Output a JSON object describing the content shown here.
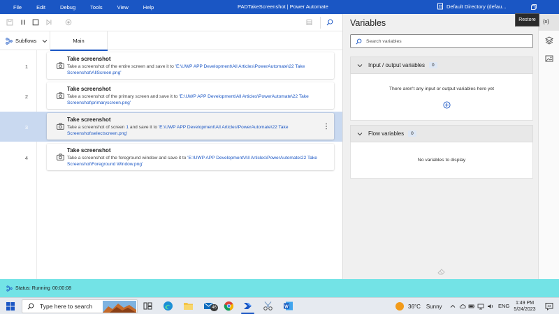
{
  "titlebar": {
    "menu": [
      "File",
      "Edit",
      "Debug",
      "Tools",
      "View",
      "Help"
    ],
    "title": "PADTakeScreenshot | Power Automate",
    "directory": "Default Directory (defau...",
    "restore_tooltip": "Restore"
  },
  "toolbar": {
    "icons": [
      "save-icon",
      "pause-icon",
      "stop-icon",
      "run-next-icon",
      "record-icon",
      "ui-elements-icon",
      "search-icon"
    ]
  },
  "tabs": {
    "subflows_label": "Subflows",
    "main_label": "Main"
  },
  "actions": [
    {
      "number": "1",
      "title": "Take screenshot",
      "desc_prefix": "Take a screenshot of the entire screen and save it to ",
      "path": "'E:\\UWP APP Development\\All Articles\\PowerAutomate\\22 Take Screenshot\\AllScreen.png'"
    },
    {
      "number": "2",
      "title": "Take screenshot",
      "desc_prefix": "Take a screenshot of the primary screen and save it to ",
      "path": "'E:\\UWP APP Development\\All Articles\\PowerAutomate\\22 Take Screenshot\\primaryscreen.png'"
    },
    {
      "number": "3",
      "title": "Take screenshot",
      "desc_prefix": "Take a screenshot of screen ",
      "screen_num": "1",
      "desc_mid": " and save it to ",
      "path": "'E:\\UWP APP Development\\All Articles\\PowerAutomate\\22 Take Screenshot\\selectscreen.png'"
    },
    {
      "number": "4",
      "title": "Take screenshot",
      "desc_prefix": "Take a screenshot of the foreground window and save it to ",
      "path": "'E:\\UWP APP Development\\All Articles\\PowerAutomate\\22 Take Screenshot\\Foreground Window.png'"
    }
  ],
  "variables": {
    "title": "Variables",
    "search_placeholder": "Search variables",
    "io_section": {
      "label": "Input / output variables",
      "count": "0",
      "empty_msg": "There aren't any input or output variables here yet"
    },
    "flow_section": {
      "label": "Flow variables",
      "count": "0",
      "empty_msg": "No variables to display"
    }
  },
  "rail": {
    "variables_label": "{x}"
  },
  "status": {
    "text": "Status: Running",
    "elapsed": "00:00:08"
  },
  "taskbar": {
    "search_placeholder": "Type here to search",
    "mail_badge": "46",
    "weather_temp": "36°C",
    "weather_cond": "Sunny",
    "language": "ENG",
    "time": "1:49 PM",
    "date": "5/24/2023"
  },
  "colors": {
    "accent": "#1a56c4",
    "status_bar": "#73e3e6",
    "selected_row": "#c9d9f0"
  }
}
